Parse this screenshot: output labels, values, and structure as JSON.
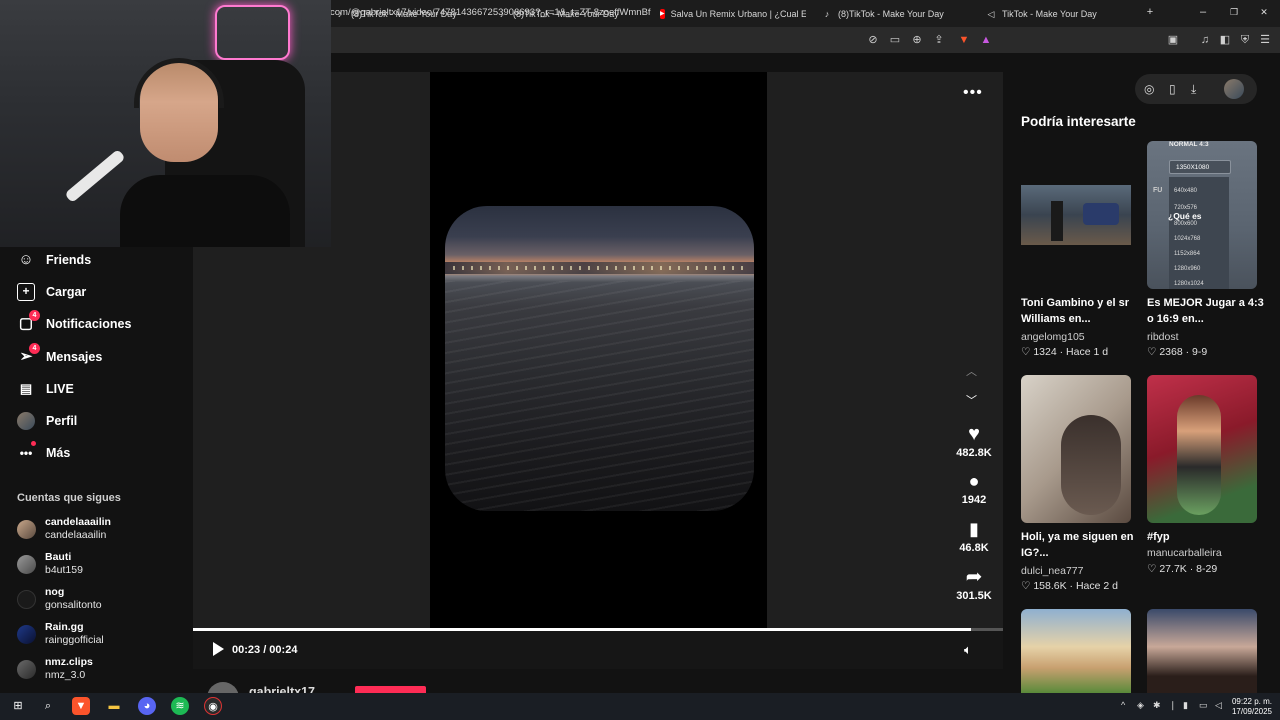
{
  "browser": {
    "tabs": [
      {
        "label": "(8)TikTok - Make Your Day",
        "icon": "tiktok-icon"
      },
      {
        "label": "(8)TikTok - Make Your Day",
        "icon": "tiktok-icon"
      },
      {
        "label": "Salva Un Remix Urbano | ¿Cual Es Tu",
        "icon": "youtube-icon"
      },
      {
        "label": "(8)TikTok - Make Your Day",
        "icon": "tiktok-icon"
      },
      {
        "label": "TikTok - Make Your Day",
        "icon": "tiktok-icon"
      }
    ],
    "new_tab": "+",
    "url": "com/@gabrieltx17/video/7478143667253906693?_r=1&_t=ZT-8zoeffWmnBf",
    "minimize": "–",
    "restore": "❐",
    "close": "✕"
  },
  "sidebar": {
    "nav": [
      {
        "label": "Friends",
        "icon": "friends-icon"
      },
      {
        "label": "Cargar",
        "icon": "upload-icon"
      },
      {
        "label": "Notificaciones",
        "icon": "inbox-icon",
        "badge": "4"
      },
      {
        "label": "Mensajes",
        "icon": "messages-icon",
        "badge": "4"
      },
      {
        "label": "LIVE",
        "icon": "live-icon"
      },
      {
        "label": "Perfil",
        "icon": "profile-avatar-icon"
      },
      {
        "label": "Más",
        "icon": "more-icon"
      }
    ],
    "following_heading": "Cuentas que sigues",
    "following": [
      {
        "name": "candelaaailin",
        "handle": "candelaaailin"
      },
      {
        "name": "Bauti",
        "handle": "b4ut159"
      },
      {
        "name": "nog",
        "handle": "gonsalitonto"
      },
      {
        "name": "Rain.gg",
        "handle": "rainggofficial"
      },
      {
        "name": "nmz.clips",
        "handle": "nmz_3.0"
      }
    ]
  },
  "video": {
    "current_time": "00:23",
    "duration": "00:24",
    "time_display": "00:23 / 00:24",
    "progress": 0.96,
    "author": "gabrieltx17",
    "more": "•••",
    "actions": [
      {
        "name": "like",
        "icon": "heart-icon",
        "count": "482.8K"
      },
      {
        "name": "comment",
        "icon": "comment-icon",
        "count": "1942"
      },
      {
        "name": "save",
        "icon": "bookmark-icon",
        "count": "46.8K"
      },
      {
        "name": "share",
        "icon": "share-icon",
        "count": "301.5K"
      }
    ]
  },
  "recommendations": {
    "title": "Podría interesarte",
    "cards": [
      {
        "title": "Toni Gambino y el sr Williams en...",
        "author": "angelomg105",
        "likes": "1324",
        "when": "Hace 1 d"
      },
      {
        "title": "Es MEJOR Jugar a 4:3 o 16:9 en...",
        "author": "ribdost",
        "likes": "2368",
        "when": "9-9"
      },
      {
        "title": "Holi, ya me siguen en IG?...",
        "author": "dulci_nea777",
        "likes": "158.6K",
        "when": "Hace 2 d"
      },
      {
        "title": "#fyp",
        "author": "manucarballeira",
        "likes": "27.7K",
        "when": "8-29"
      }
    ],
    "thumb_text": {
      "top": "NORMAL 4:3",
      "res": "1350X1080",
      "overlay": "¿Qué es",
      "list": [
        "640x480",
        "720x576",
        "800x600",
        "1024x768",
        "1152x864",
        "1280x960",
        "1280x1024"
      ]
    }
  },
  "taskbar": {
    "time": "09:22 p. m.",
    "date": "17/09/2025"
  },
  "colors": {
    "accent": "#fe2c55",
    "background": "#121212"
  }
}
